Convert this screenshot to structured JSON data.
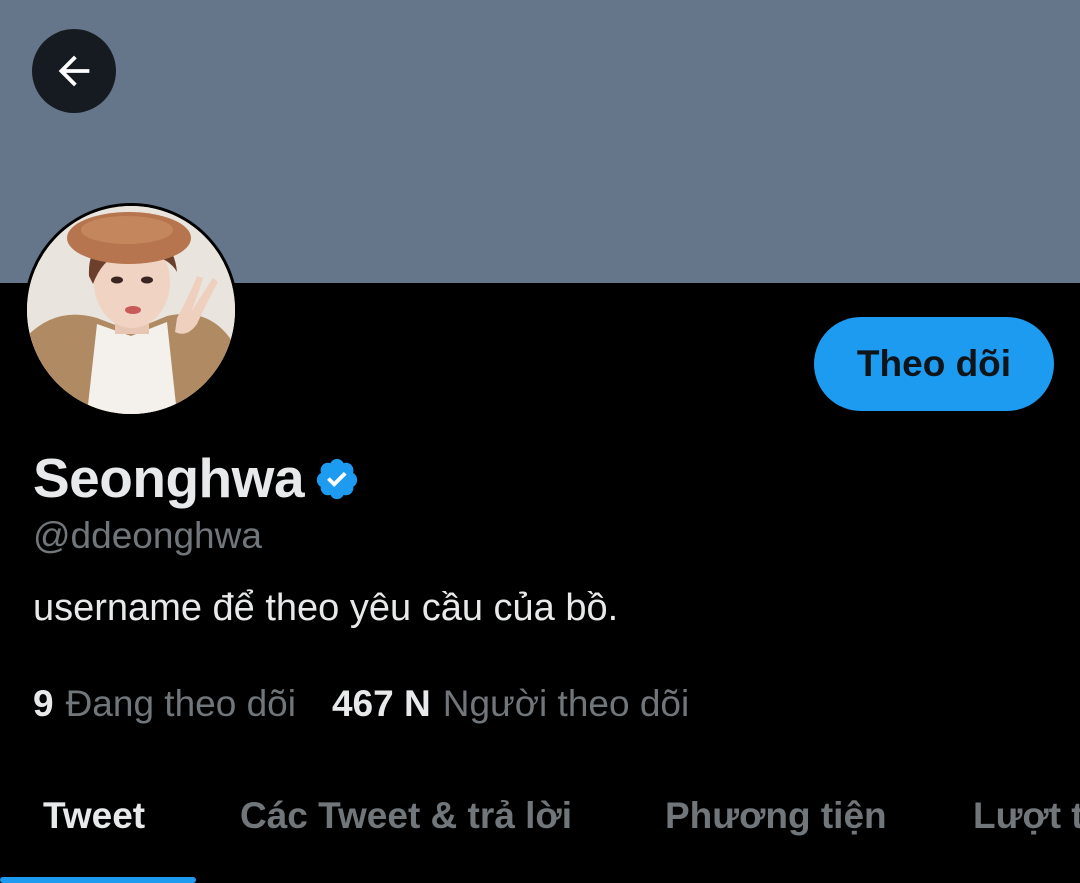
{
  "header": {
    "back_icon": "arrow-left-icon",
    "banner_color": "#66768a"
  },
  "profile": {
    "display_name": "Seonghwa",
    "verified_icon": "verified-badge-icon",
    "handle": "@ddeonghwa",
    "bio": "username để theo yêu cầu của bồ.",
    "follow_label": "Theo dõi"
  },
  "stats": {
    "following_count": "9",
    "following_label": "Đang theo dõi",
    "followers_count": "467 N",
    "followers_label": "Người theo dõi"
  },
  "tabs": [
    {
      "label": "Tweet",
      "active": true
    },
    {
      "label": "Các Tweet & trả lời",
      "active": false
    },
    {
      "label": "Phương tiện",
      "active": false
    },
    {
      "label": "Lượt thích",
      "active": false
    }
  ],
  "colors": {
    "accent": "#1d9bf0",
    "background": "#000000",
    "primary_text": "#e7e9ea",
    "secondary_text": "#71767b"
  }
}
